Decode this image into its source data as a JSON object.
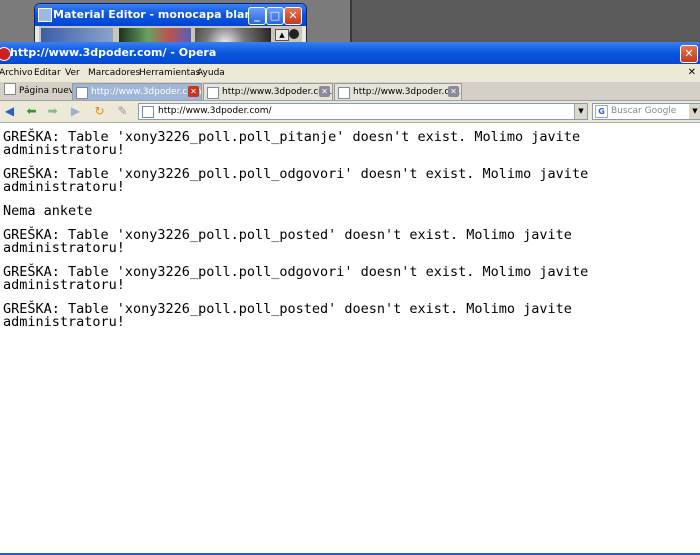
{
  "material_editor": {
    "title": "Material Editor - monocapa blanco"
  },
  "browser": {
    "title": "http://www.3dpoder.com/ - Opera",
    "menu": [
      "Archivo",
      "Editar",
      "Ver",
      "Marcadores",
      "Herramientas",
      "Ayuda"
    ],
    "tabs": {
      "new_page": "Página nueva",
      "items": [
        {
          "label": "http://www.3dpoder.com/",
          "active": true
        },
        {
          "label": "http://www.3dpoder.co...",
          "active": false
        },
        {
          "label": "http://www.3dpoder.co...",
          "active": false
        }
      ]
    },
    "address": "http://www.3dpoder.com/",
    "search_placeholder": "Buscar Google"
  },
  "page": {
    "messages": [
      "GREŠKA: Table 'xony3226_poll.poll_pitanje' doesn't exist. Molimo javite\nadministratoru!",
      "GREŠKA: Table 'xony3226_poll.poll_odgovori' doesn't exist. Molimo javite\nadministratoru!",
      "Nema ankete",
      "GREŠKA: Table 'xony3226_poll.poll_posted' doesn't exist. Molimo javite\nadministratoru!",
      "GREŠKA: Table 'xony3226_poll.poll_odgovori' doesn't exist. Molimo javite\nadministratoru!",
      "GREŠKA: Table 'xony3226_poll.poll_posted' doesn't exist. Molimo javite\nadministratoru!"
    ]
  },
  "colors": {
    "titlebar": "#0a58e0",
    "chrome": "#ece9d8",
    "close": "#c3391c"
  }
}
